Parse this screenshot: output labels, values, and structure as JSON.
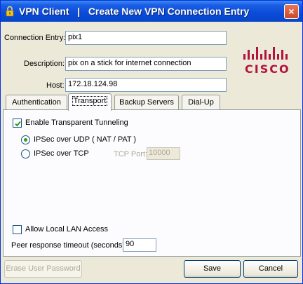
{
  "window": {
    "title": "VPN Client   |   Create New VPN Connection Entry",
    "close_label": "×"
  },
  "form": {
    "connection_entry_label": "Connection Entry:",
    "connection_entry_value": "pix1",
    "description_label": "Description:",
    "description_value": "pix on a stick for internet connection",
    "host_label": "Host:",
    "host_value": "172.18.124.98"
  },
  "logo": {
    "text": "CISCO",
    "color": "#b4123c"
  },
  "tabs": [
    {
      "label": "Authentication",
      "active": false
    },
    {
      "label": "Transport",
      "active": true
    },
    {
      "label": "Backup Servers",
      "active": false
    },
    {
      "label": "Dial-Up",
      "active": false
    }
  ],
  "transport": {
    "enable_tunneling_label": "Enable Transparent Tunneling",
    "enable_tunneling_checked": true,
    "ipsec_udp_label": "IPSec over UDP ( NAT / PAT )",
    "ipsec_udp_selected": true,
    "ipsec_tcp_label": "IPSec over TCP",
    "tcp_port_label": "TCP Port:",
    "tcp_port_value": "10000",
    "allow_lan_label": "Allow Local LAN Access",
    "allow_lan_checked": false,
    "peer_timeout_label": "Peer response timeout (seconds):",
    "peer_timeout_value": "90"
  },
  "buttons": {
    "erase_label": "Erase User Password",
    "save_label": "Save",
    "cancel_label": "Cancel"
  }
}
